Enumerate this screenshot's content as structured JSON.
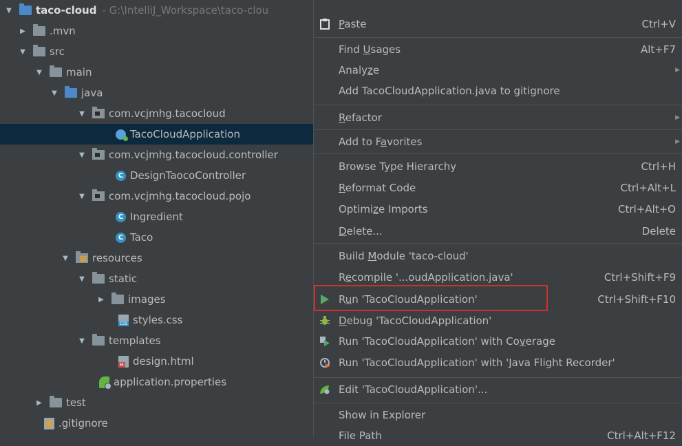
{
  "tree": {
    "project_name": "taco-cloud",
    "project_path": "- G:\\IntelliJ_Workspace\\taco-clou",
    "items": [
      {
        "label": ".mvn"
      },
      {
        "label": "src"
      },
      {
        "label": "main"
      },
      {
        "label": "java"
      },
      {
        "label": "com.vcjmhg.tacocloud"
      },
      {
        "label": "TacoCloudApplication"
      },
      {
        "label": "com.vcjmhg.tacocloud.controller"
      },
      {
        "label": "DesignTaocoController"
      },
      {
        "label": "com.vcjmhg.tacocloud.pojo"
      },
      {
        "label": "Ingredient"
      },
      {
        "label": "Taco"
      },
      {
        "label": "resources"
      },
      {
        "label": "static"
      },
      {
        "label": "images"
      },
      {
        "label": "styles.css"
      },
      {
        "label": "templates"
      },
      {
        "label": "design.html"
      },
      {
        "label": "application.properties"
      },
      {
        "label": "test"
      },
      {
        "label": ".gitignore"
      }
    ],
    "class_icon_letter": "C"
  },
  "menu": {
    "paste": {
      "pre": "",
      "u": "P",
      "post": "aste",
      "shortcut": "Ctrl+V"
    },
    "find_usages": {
      "pre": "Find ",
      "u": "U",
      "post": "sages",
      "shortcut": "Alt+F7"
    },
    "analyze": {
      "pre": "Analy",
      "u": "z",
      "post": "e"
    },
    "add_gitignore": {
      "label": "Add TacoCloudApplication.java to gitignore"
    },
    "refactor": {
      "pre": "",
      "u": "R",
      "post": "efactor"
    },
    "add_favorites": {
      "pre": "Add to F",
      "u": "a",
      "post": "vorites"
    },
    "browse_hierarchy": {
      "label": "Browse Type Hierarchy",
      "shortcut": "Ctrl+H"
    },
    "reformat": {
      "pre": "",
      "u": "R",
      "post": "eformat Code",
      "shortcut": "Ctrl+Alt+L"
    },
    "optimize": {
      "pre": "Optimi",
      "u": "z",
      "post": "e Imports",
      "shortcut": "Ctrl+Alt+O"
    },
    "delete": {
      "pre": "",
      "u": "D",
      "post": "elete...",
      "shortcut": "Delete"
    },
    "build_module": {
      "pre": "Build ",
      "u": "M",
      "post": "odule 'taco-cloud'"
    },
    "recompile": {
      "pre": "R",
      "u": "e",
      "post": "compile '...oudApplication.java'",
      "shortcut": "Ctrl+Shift+F9"
    },
    "run": {
      "pre": "R",
      "u": "u",
      "post": "n 'TacoCloudApplication'",
      "shortcut": "Ctrl+Shift+F10"
    },
    "debug": {
      "pre": "",
      "u": "D",
      "post": "ebug 'TacoCloudApplication'"
    },
    "run_coverage": {
      "pre": "Run 'TacoCloudApplication' with Co",
      "u": "v",
      "post": "erage"
    },
    "run_jfr": {
      "label": "Run 'TacoCloudApplication' with 'Java Flight Recorder'"
    },
    "edit_config": {
      "label": "Edit 'TacoCloudApplication'..."
    },
    "show_explorer": {
      "label": "Show in Explorer"
    },
    "file_path": {
      "label": "File Path",
      "shortcut": "Ctrl+Alt+F12"
    }
  },
  "colors": {
    "highlight": "#d0312d",
    "selected_row": "#0d293e",
    "run_green": "#59a869"
  }
}
